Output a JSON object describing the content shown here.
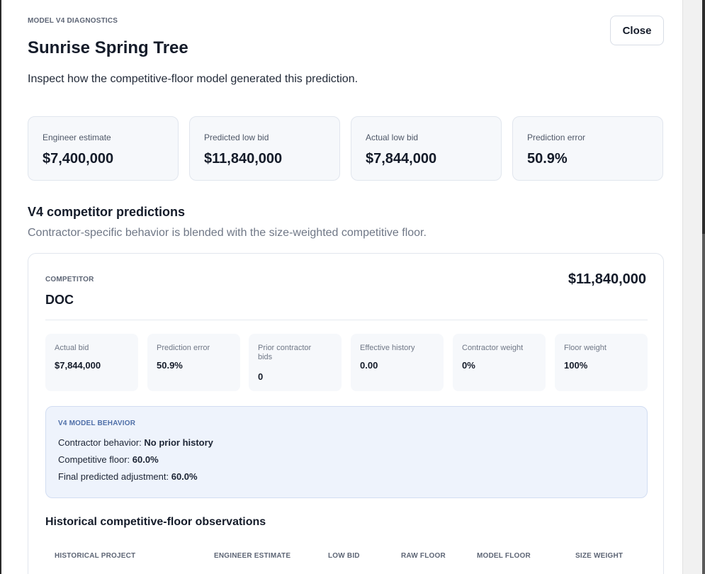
{
  "modal": {
    "eyebrow": "MODEL V4 DIAGNOSTICS",
    "title": "Sunrise Spring Tree",
    "subtitle": "Inspect how the competitive-floor model generated this prediction.",
    "close_label": "Close"
  },
  "stats": [
    {
      "label": "Engineer estimate",
      "value": "$7,400,000"
    },
    {
      "label": "Predicted low bid",
      "value": "$11,840,000"
    },
    {
      "label": "Actual low bid",
      "value": "$7,844,000"
    },
    {
      "label": "Prediction error",
      "value": "50.9%"
    }
  ],
  "predictions": {
    "title": "V4 competitor predictions",
    "subtitle": "Contractor-specific behavior is blended with the size-weighted competitive floor."
  },
  "competitor": {
    "eyebrow": "COMPETITOR",
    "name": "DOC",
    "amount": "$11,840,000",
    "metrics": [
      {
        "label": "Actual bid",
        "value": "$7,844,000"
      },
      {
        "label": "Prediction error",
        "value": "50.9%"
      },
      {
        "label": "Prior contractor bids",
        "value": "0"
      },
      {
        "label": "Effective history",
        "value": "0.00"
      },
      {
        "label": "Contractor weight",
        "value": "0%"
      },
      {
        "label": "Floor weight",
        "value": "100%"
      }
    ],
    "behavior": {
      "eyebrow": "V4 MODEL BEHAVIOR",
      "contractor_label": "Contractor behavior:",
      "contractor_value": "No prior history",
      "floor_label": "Competitive floor:",
      "floor_value": "60.0%",
      "adjustment_label": "Final predicted adjustment:",
      "adjustment_value": "60.0%"
    },
    "history": {
      "title": "Historical competitive-floor observations",
      "columns": [
        "HISTORICAL PROJECT",
        "ENGINEER ESTIMATE",
        "LOW BID",
        "RAW FLOOR",
        "MODEL FLOOR",
        "SIZE WEIGHT"
      ]
    }
  }
}
